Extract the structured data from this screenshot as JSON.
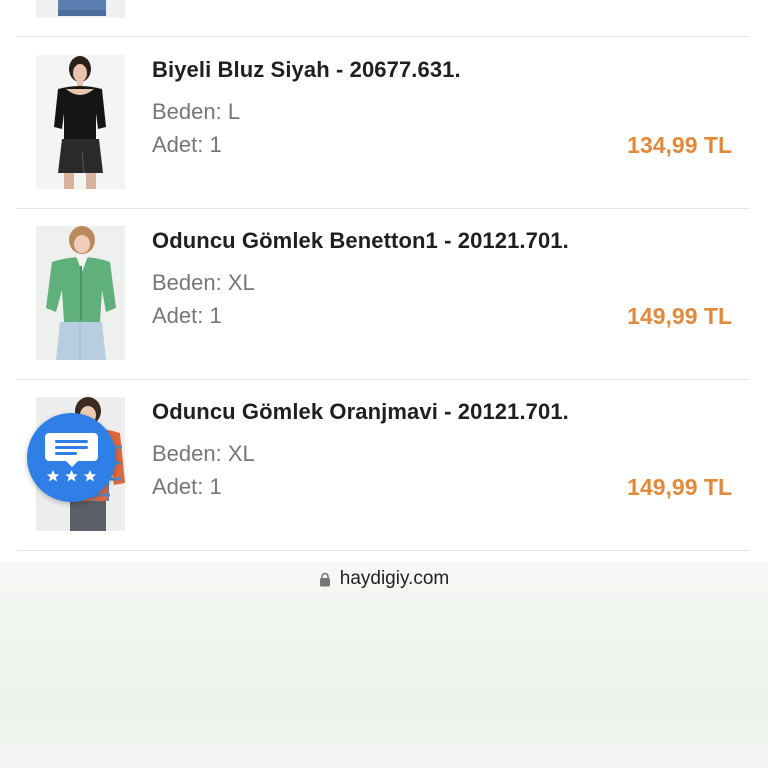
{
  "cart": {
    "items": [
      {
        "title": "Biyeli Bluz Siyah - 20677.631.",
        "size": "Beden: L",
        "quantity": "Adet: 1",
        "price": "134,99 TL"
      },
      {
        "title": "Oduncu Gömlek Benetton1 - 20121.701.",
        "size": "Beden: XL",
        "quantity": "Adet: 1",
        "price": "149,99 TL"
      },
      {
        "title": "Oduncu Gömlek Oranjmavi - 20121.701.",
        "size": "Beden: XL",
        "quantity": "Adet: 1",
        "price": "149,99 TL"
      }
    ]
  },
  "review_widget": {
    "icon": "review-chat-stars-icon",
    "color": "#2f7fe6"
  },
  "browser": {
    "url": "haydigiy.com",
    "lock_icon": "lock-icon"
  },
  "colors": {
    "price": "#e08a3c",
    "title": "#1f1f1f",
    "meta": "#767676",
    "separator": "#e4e4e4"
  }
}
